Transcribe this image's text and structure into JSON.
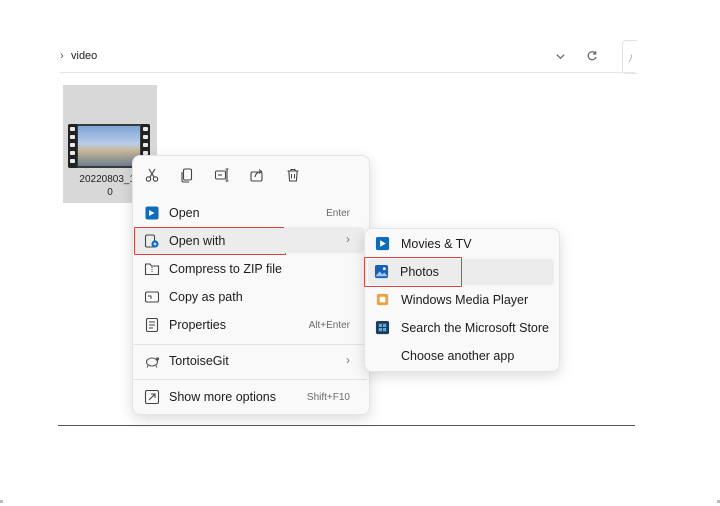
{
  "breadcrumb": {
    "separator": "›",
    "folder": "video"
  },
  "address_icons": {
    "dropdown": "chevron-down-icon",
    "refresh": "refresh-icon",
    "search": "search-icon"
  },
  "search_glyph": "ﾉ",
  "file": {
    "name_line1": "20220803_14",
    "name_line2": "0"
  },
  "quick_actions": [
    "cut-icon",
    "copy-icon",
    "rename-icon",
    "share-icon",
    "delete-icon"
  ],
  "context_menu": {
    "open": {
      "label": "Open",
      "key": "Enter"
    },
    "open_with": {
      "label": "Open with",
      "arrow": "›"
    },
    "compress": {
      "label": "Compress to ZIP file"
    },
    "copy_path": {
      "label": "Copy as path"
    },
    "properties": {
      "label": "Properties",
      "key": "Alt+Enter"
    },
    "tortoisegit": {
      "label": "TortoiseGit",
      "arrow": "›"
    },
    "more_options": {
      "label": "Show more options",
      "key": "Shift+F10"
    }
  },
  "submenu": {
    "movies": {
      "label": "Movies & TV"
    },
    "photos": {
      "label": "Photos"
    },
    "wmp": {
      "label": "Windows Media Player"
    },
    "store": {
      "label": "Search the Microsoft Store"
    },
    "another": {
      "label": "Choose another app"
    }
  },
  "colors": {
    "highlight": "#d6443f",
    "accent": "#0f6cbd",
    "menu_bg": "#f9f9f9"
  }
}
